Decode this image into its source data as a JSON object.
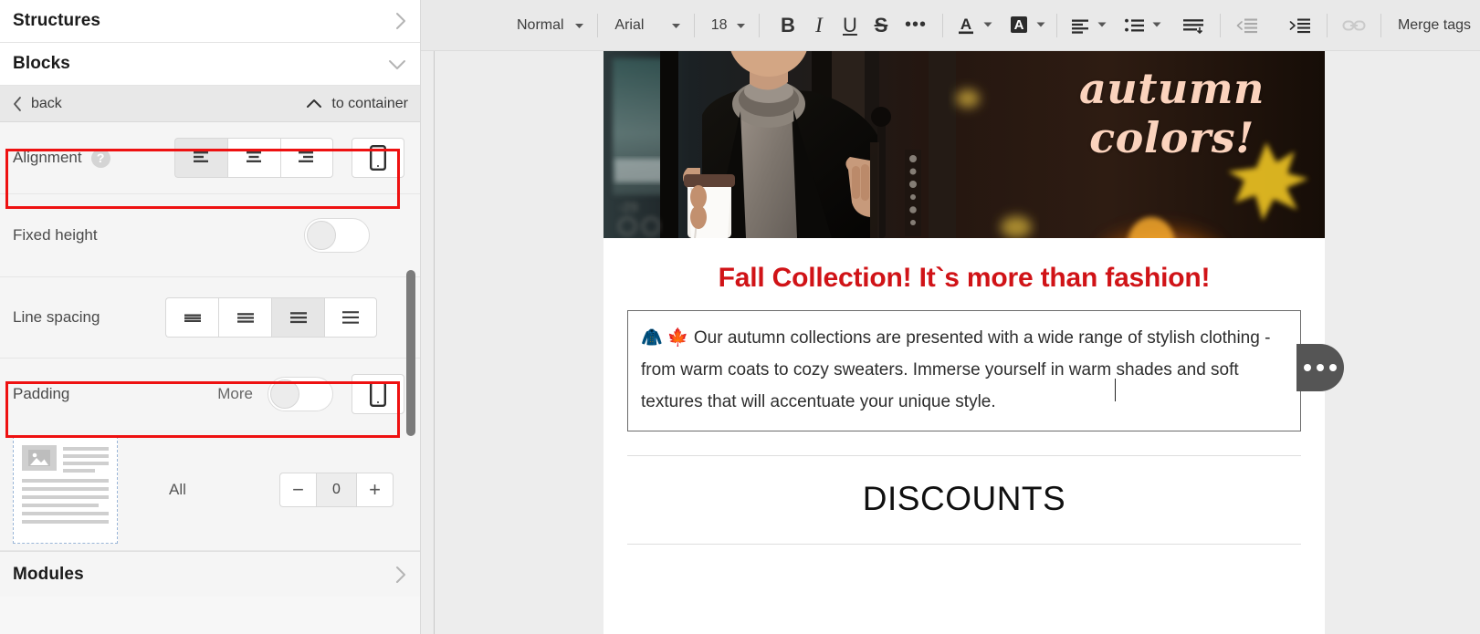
{
  "sidebar": {
    "sections": [
      {
        "title": "Structures",
        "chevron": "chevron-right"
      },
      {
        "title": "Blocks",
        "chevron": "chevron-down"
      },
      {
        "title": "Modules",
        "chevron": "chevron-right"
      }
    ],
    "backbar": {
      "back_label": "back",
      "to_container_label": "to container"
    },
    "alignment": {
      "label": "Alignment",
      "help": "?",
      "options": [
        "align-left",
        "align-center",
        "align-right"
      ],
      "selected_index": 0,
      "mobile_button": "mobile-device"
    },
    "fixed_height": {
      "label": "Fixed height",
      "state": "off"
    },
    "line_spacing": {
      "label": "Line spacing",
      "options": [
        "spacing-1",
        "spacing-2",
        "spacing-3",
        "spacing-4"
      ],
      "selected_index": 2
    },
    "padding": {
      "label": "Padding",
      "more_label": "More",
      "toggle_state": "off",
      "mobile_button": "mobile-device",
      "all_label": "All",
      "value": "0",
      "minus": "−",
      "plus": "+"
    }
  },
  "toolbar": {
    "style": "Normal",
    "font": "Arial",
    "size": "18",
    "bold": "B",
    "italic": "I",
    "underline": "U",
    "strikethrough": "S",
    "more": "•••",
    "text_color": "A",
    "highlight_color": "A",
    "merge_tags": "Merge tags"
  },
  "email": {
    "hero": {
      "script_line1": "autumn",
      "script_line2": "colors!",
      "script_color": "#fbd3bd",
      "alt": "woman in black coat holding coffee cup in doorway"
    },
    "headline": "Fall Collection! It`s more than fashion!",
    "headline_color": "#d01317",
    "body": "🧥 🍁 Our autumn collections are presented with a wide range of stylish clothing - from warm coats to cozy sweaters. Immerse yourself in warm shades and soft textures that will accentuate your unique style.",
    "discounts": "DISCOUNTS"
  },
  "colors": {
    "highlight_red": "#ee1111",
    "sidebar_bg": "#f5f5f5",
    "toolbar_bg": "#e9e9e9",
    "canvas_bg": "#ededed"
  }
}
